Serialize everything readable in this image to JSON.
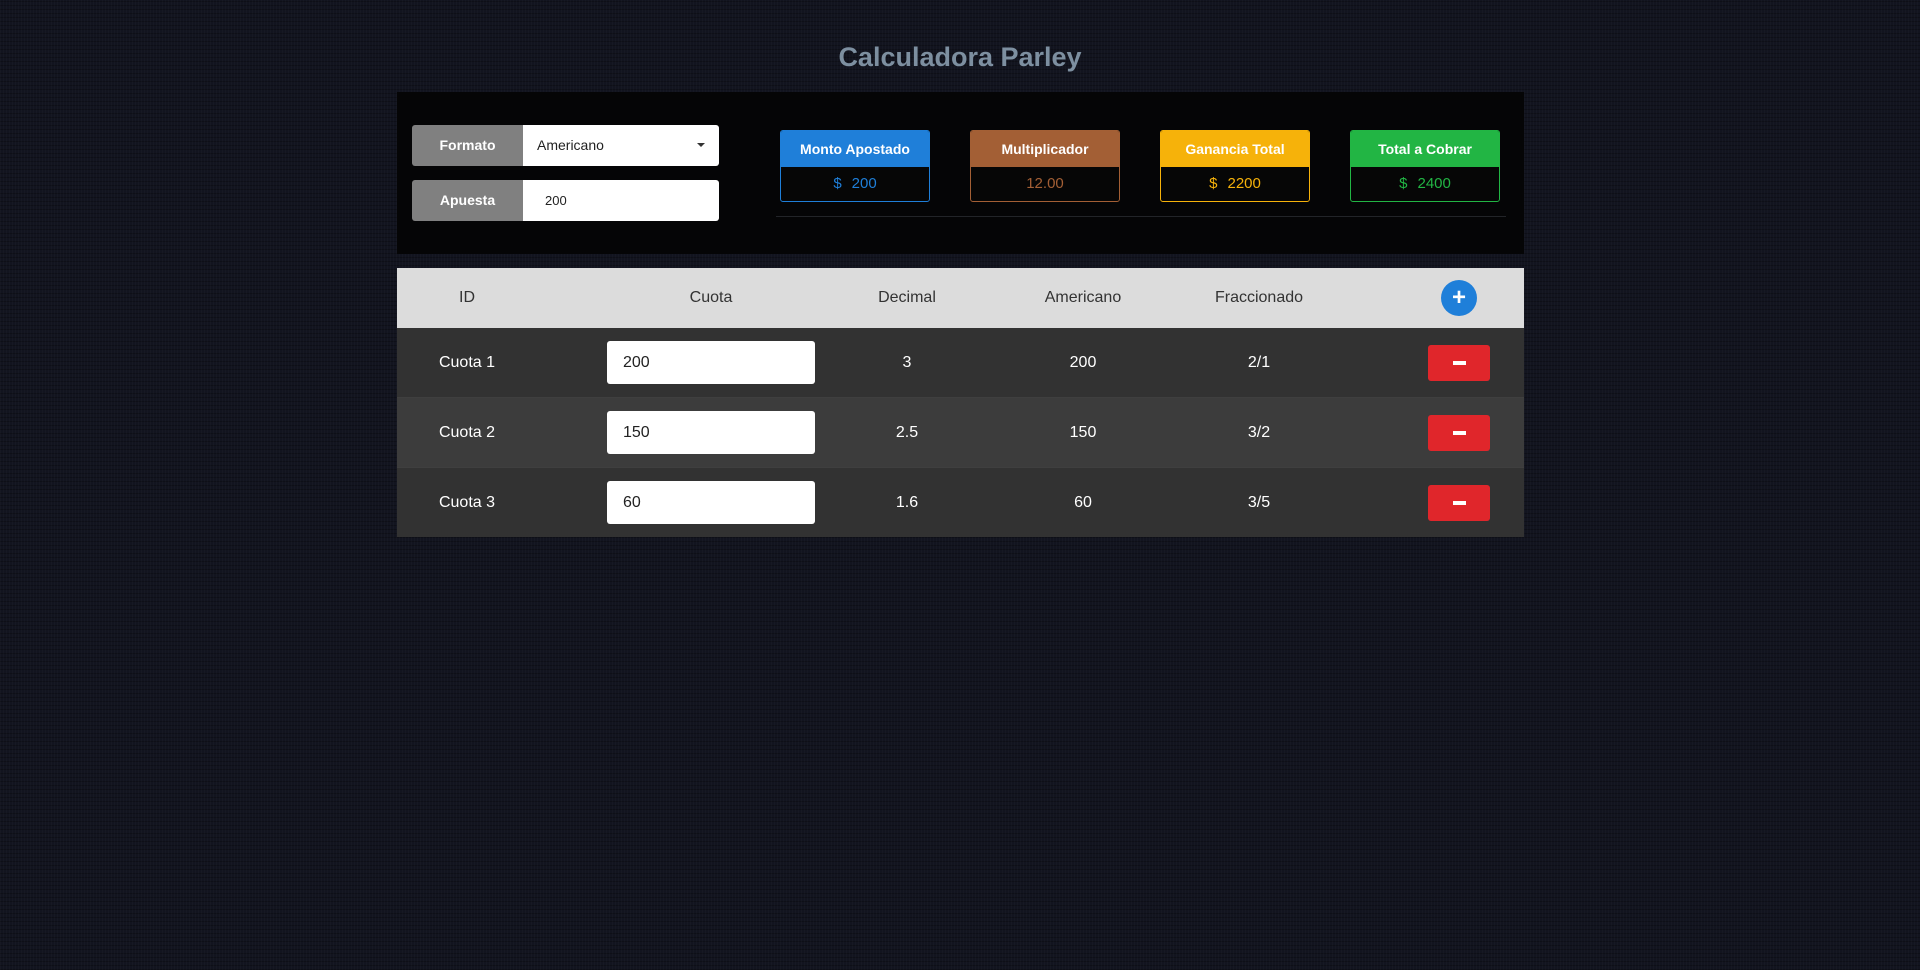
{
  "page": {
    "title": "Calculadora Parley"
  },
  "controls": {
    "format_label": "Formato",
    "format_value": "Americano",
    "bet_label": "Apuesta",
    "bet_value": "200"
  },
  "stats": [
    {
      "label": "Monto Apostado",
      "currency": "$",
      "value": "200",
      "color": "#1f7fd9"
    },
    {
      "label": "Multiplicador",
      "currency": "",
      "value": "12.00",
      "color": "#a35f35"
    },
    {
      "label": "Ganancia Total",
      "currency": "$",
      "value": "2200",
      "color": "#f6b20a"
    },
    {
      "label": "Total a Cobrar",
      "currency": "$",
      "value": "2400",
      "color": "#22b544"
    }
  ],
  "table": {
    "headers": {
      "id": "ID",
      "cuota": "Cuota",
      "decimal": "Decimal",
      "americano": "Americano",
      "fraccionado": "Fraccionado"
    },
    "add_icon": "plus-icon",
    "remove_icon": "minus-icon",
    "rows": [
      {
        "id": "Cuota 1",
        "cuota": "200",
        "decimal": "3",
        "americano": "200",
        "fraccionado": "2/1"
      },
      {
        "id": "Cuota 2",
        "cuota": "150",
        "decimal": "2.5",
        "americano": "150",
        "fraccionado": "3/2"
      },
      {
        "id": "Cuota 3",
        "cuota": "60",
        "decimal": "1.6",
        "americano": "60",
        "fraccionado": "3/5"
      }
    ]
  }
}
